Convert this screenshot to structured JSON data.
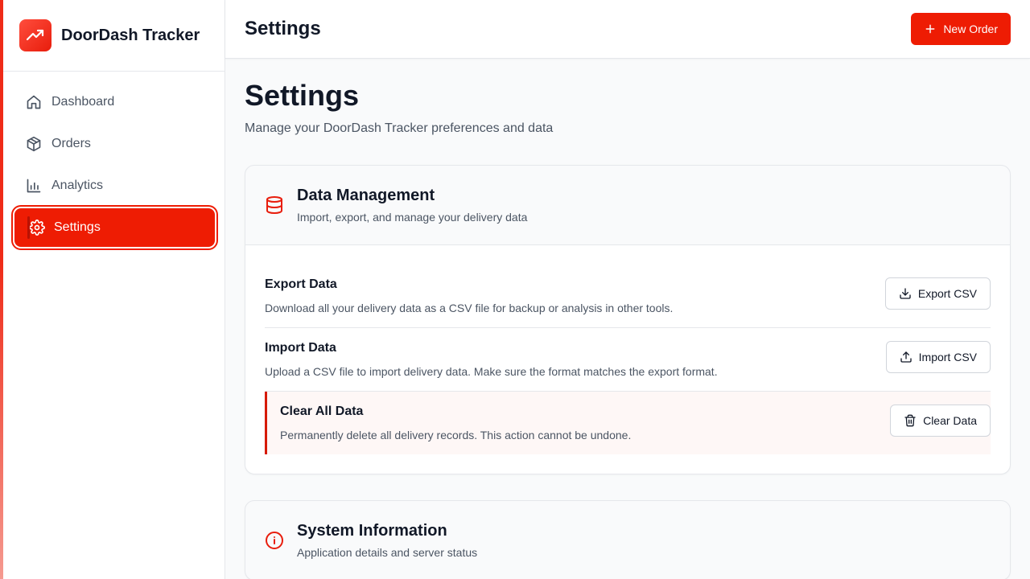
{
  "brand": {
    "title": "DoorDash Tracker",
    "logo_icon": "trending-up-icon"
  },
  "sidebar": {
    "items": [
      {
        "label": "Dashboard",
        "icon": "home-icon",
        "active": false
      },
      {
        "label": "Orders",
        "icon": "package-icon",
        "active": false
      },
      {
        "label": "Analytics",
        "icon": "bar-chart-icon",
        "active": false
      },
      {
        "label": "Settings",
        "icon": "gear-icon",
        "active": true
      }
    ]
  },
  "header": {
    "title": "Settings",
    "new_order_label": "New Order"
  },
  "main": {
    "title": "Settings",
    "subtitle": "Manage your DoorDash Tracker preferences and data",
    "data_management": {
      "title": "Data Management",
      "description": "Import, export, and manage your delivery data",
      "icon": "database-icon",
      "rows": [
        {
          "title": "Export Data",
          "description": "Download all your delivery data as a CSV file for backup or analysis in other tools.",
          "button": "Export CSV",
          "icon": "download-icon"
        },
        {
          "title": "Import Data",
          "description": "Upload a CSV file to import delivery data. Make sure the format matches the export format.",
          "button": "Import CSV",
          "icon": "upload-icon"
        },
        {
          "title": "Clear All Data",
          "description": "Permanently delete all delivery records. This action cannot be undone.",
          "button": "Clear Data",
          "icon": "trash-icon"
        }
      ]
    },
    "system_info": {
      "title": "System Information",
      "description": "Application details and server status",
      "icon": "info-icon"
    }
  },
  "colors": {
    "accent": "#ee1c03",
    "danger_bg": "#fef7f6"
  }
}
